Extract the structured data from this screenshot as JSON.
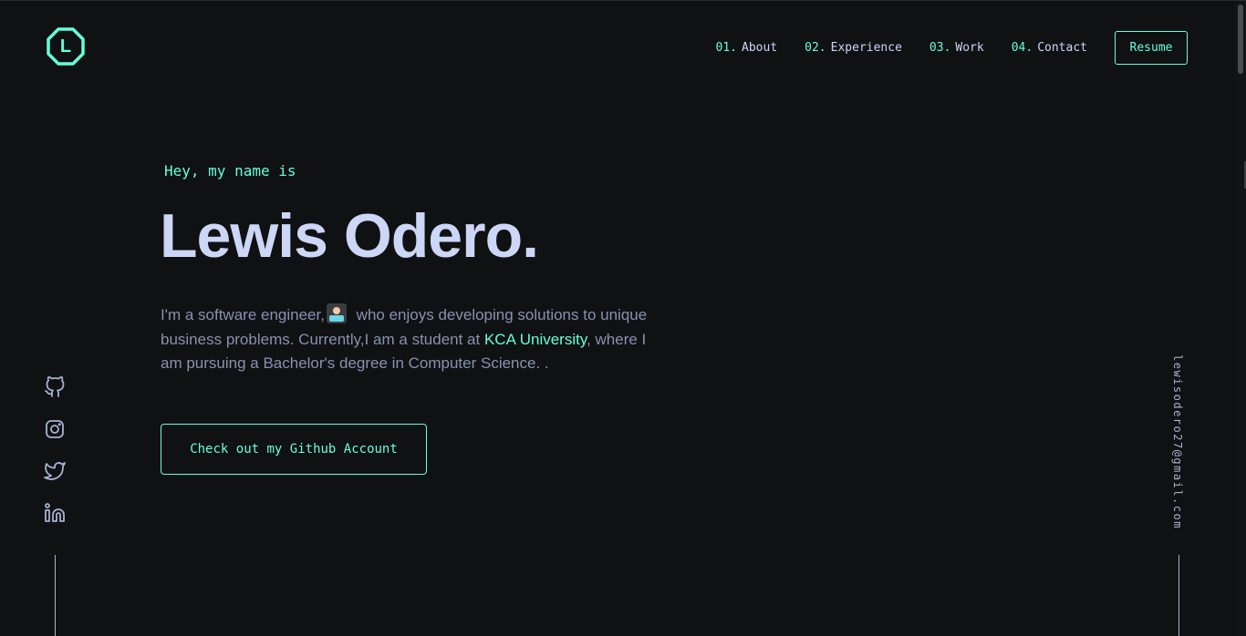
{
  "header": {
    "logo_letter": "L",
    "nav": [
      {
        "num": "01.",
        "label": "About"
      },
      {
        "num": "02.",
        "label": "Experience"
      },
      {
        "num": "03.",
        "label": "Work"
      },
      {
        "num": "04.",
        "label": "Contact"
      }
    ],
    "resume_label": "Resume"
  },
  "hero": {
    "greeting": "Hey, my name is",
    "name": "Lewis Odero.",
    "intro_part1": "I'm a software engineer,",
    "intro_part2": " who enjoys developing solutions to unique business problems. Currently,I am a student at ",
    "university": "KCA University",
    "intro_part3": ", where I am pursuing a Bachelor's degree in Computer Science. .",
    "cta_label": "Check out my Github Account"
  },
  "social": {
    "icons": [
      "github-icon",
      "instagram-icon",
      "twitter-icon",
      "linkedin-icon"
    ]
  },
  "email": "lewisodero27@gmail.com",
  "colors": {
    "background": "#101113",
    "accent": "#64ffda",
    "heading": "#ccd6f6",
    "body_text": "#8892b0"
  }
}
